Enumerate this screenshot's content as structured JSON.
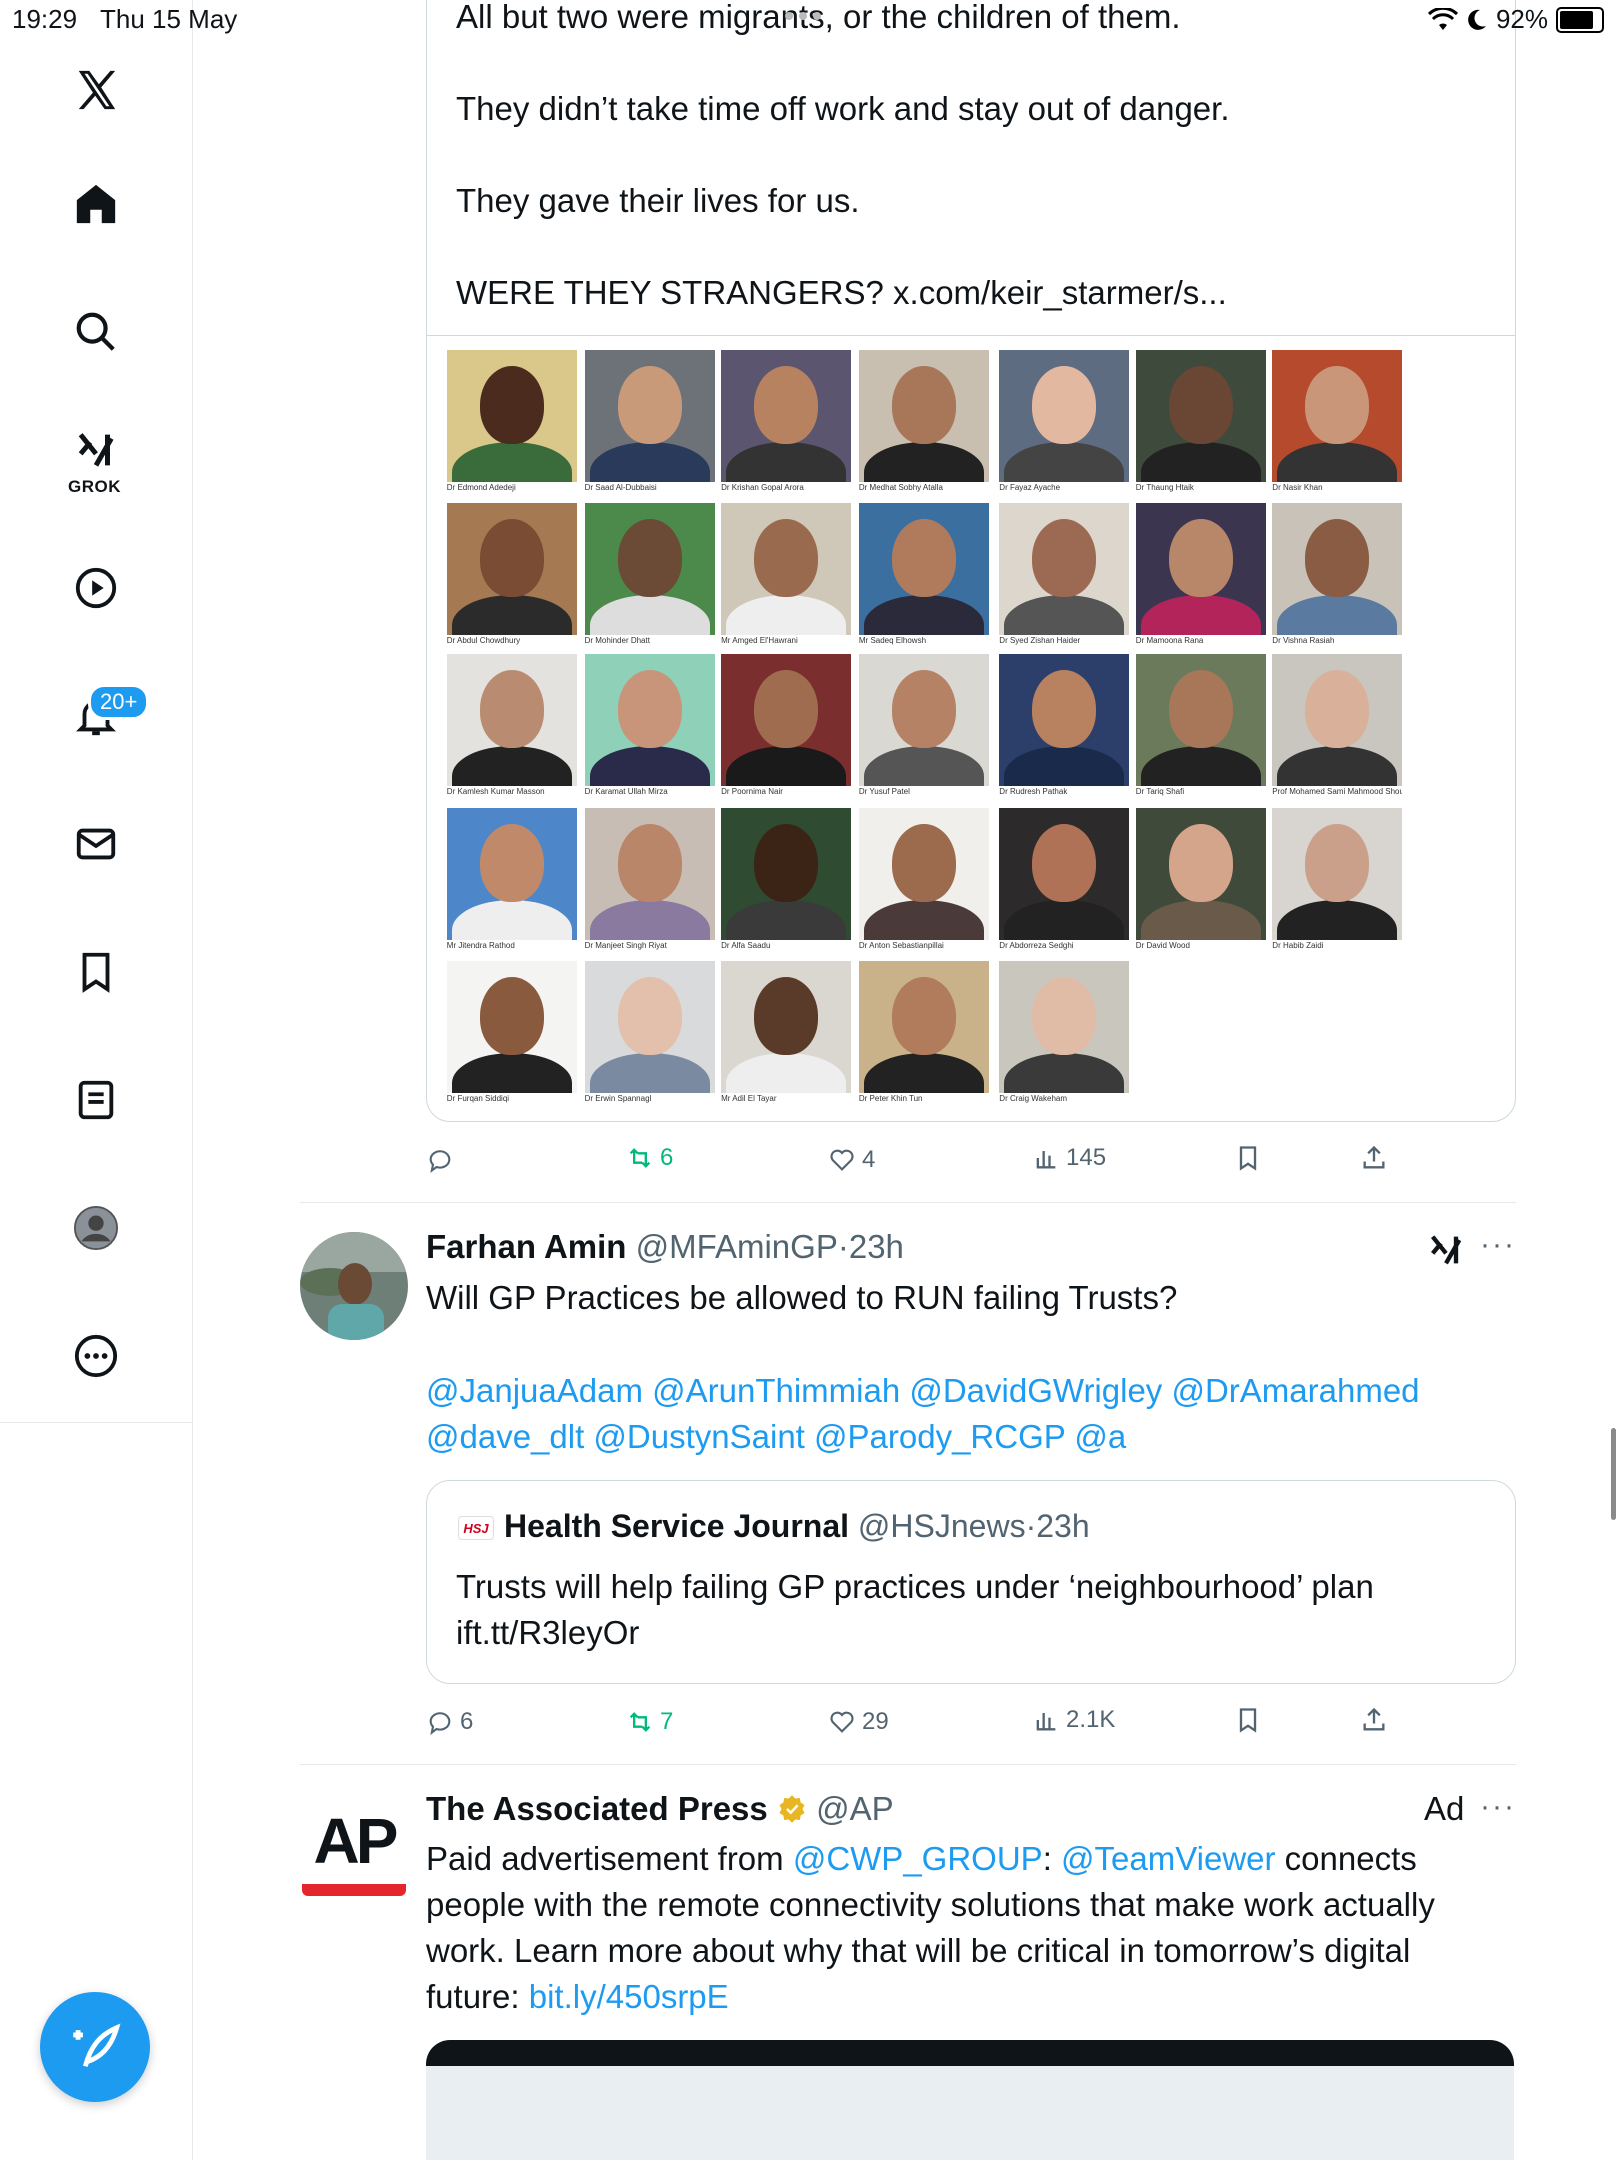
{
  "status_bar": {
    "time": "19:29",
    "date": "Thu 15 May",
    "battery": "92%",
    "battery_level": 0.92
  },
  "sidebar": {
    "items": [
      {
        "name": "x-logo-icon"
      },
      {
        "name": "home-icon"
      },
      {
        "name": "search-icon"
      },
      {
        "name": "grok-icon",
        "label": "GROK"
      },
      {
        "name": "video-icon"
      },
      {
        "name": "notifications-icon",
        "badge": "20+"
      },
      {
        "name": "messages-icon"
      },
      {
        "name": "bookmarks-icon"
      },
      {
        "name": "lists-icon"
      },
      {
        "name": "profile-icon"
      },
      {
        "name": "more-icon"
      }
    ],
    "compose": "compose-icon"
  },
  "tweet1": {
    "quote_lines": [
      "All but two were migrants, or the children of them.",
      "They didn’t take time off work and stay out of danger.",
      "They gave their lives for us.",
      "WERE THEY STRANGERS? x.com/keir_starmer/s..."
    ],
    "photo_captions": [
      "Dr Edmond Adedeji",
      "Dr Saad Al-Dubbaisi",
      "Dr Krishan Gopal Arora",
      "Dr Medhat Sobhy Atalla",
      "Dr Fayaz Ayache",
      "Dr Thaung Htaik",
      "Dr Nasir Khan",
      "Dr Abdul Chowdhury",
      "Dr Mohinder Dhatt",
      "Mr Amged El'Hawrani",
      "Mr Sadeq Elhowsh",
      "Dr Syed Zishan Haider",
      "Dr Mamoona Rana",
      "Dr Vishna Rasiah",
      "Dr Kamlesh Kumar Masson",
      "Dr Karamat Ullah Mirza",
      "Dr Poornima Nair",
      "Dr Yusuf Patel",
      "Dr Rudresh Pathak",
      "Dr Tariq Shafi",
      "Prof Mohamed Sami Mahmood Shousha",
      "Mr Jitendra Rathod",
      "Dr Manjeet Singh Riyat",
      "Dr Alfa Saadu",
      "Dr Anton Sebastianpillai",
      "Dr Abdorreza Sedghi",
      "Dr David Wood",
      "Dr Habib Zaidi",
      "Dr Furqan Siddiqi",
      "Dr Erwin Spannagl",
      "Mr Adil El Tayar",
      "Dr Peter Khin Tun",
      "Dr Craig Wakeham"
    ],
    "actions": {
      "reply": "",
      "retweets": "6",
      "likes": "4",
      "views": "145"
    }
  },
  "tweet2": {
    "name": "Farhan Amin",
    "handle": "@MFAminGP",
    "time": "23h",
    "text": "Will GP Practices be allowed to RUN failing Trusts?",
    "mentions_line1": "@JanjuaAdam @ArunThimmiah @DavidGWrigley @DrAmarahmed",
    "mentions_line2": "@dave_dlt @DustynSaint  @Parody_RCGP @a",
    "quote": {
      "logo": "HSJ",
      "name": "Health Service Journal",
      "handle": "@HSJnews",
      "time": "23h",
      "text1": "Trusts will help failing GP practices under ‘neighbourhood’ plan",
      "text2": "ift.tt/R3leyOr"
    },
    "actions": {
      "reply": "6",
      "retweets": "7",
      "likes": "29",
      "views": "2.1K"
    }
  },
  "tweet3": {
    "avatar_text": "AP",
    "name": "The Associated Press",
    "handle": "@AP",
    "ad_label": "Ad",
    "line1_prefix": "Paid advertisement from ",
    "line1_link1": "@CWP_GROUP",
    "line1_sep": ": ",
    "line1_link2": "@TeamViewer",
    "line1_suffix": " connects",
    "line2": "people with the remote connectivity solutions that make work actually",
    "line3": "work. Learn more about why that will be critical in tomorrow’s digital",
    "line4_prefix": "future: ",
    "line4_link": "bit.ly/450srpE"
  },
  "colors": {
    "accent": "#1d9bf0",
    "retweet": "#00ba7c",
    "muted": "#536471",
    "ap_red": "#e3262d"
  }
}
